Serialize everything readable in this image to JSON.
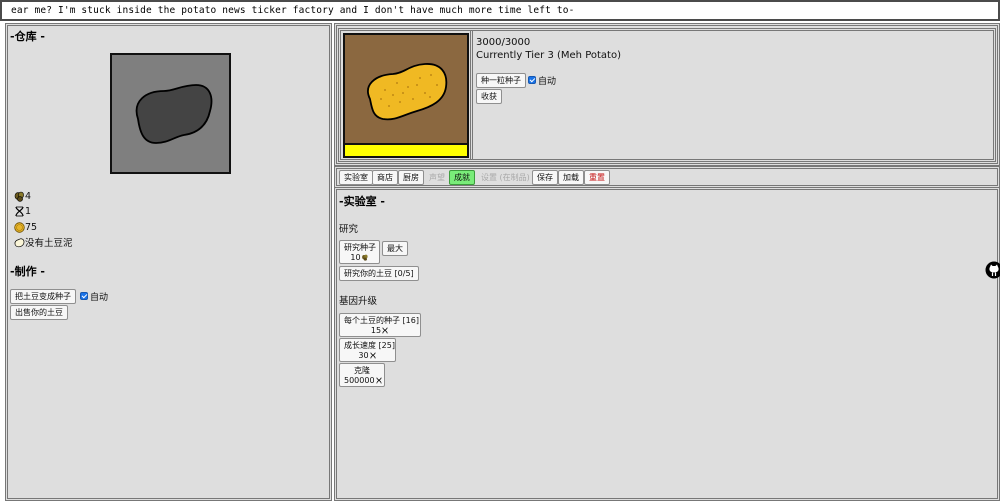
{
  "ticker": {
    "text": "ear me? I'm stuck inside the potato news ticker factory and I don't have much more time left to-"
  },
  "storage": {
    "title": "-仓库 -",
    "stats": [
      {
        "icon": "seed-icon",
        "value": "4"
      },
      {
        "icon": "dna-icon",
        "value": "1"
      },
      {
        "icon": "coin-icon",
        "value": "75"
      },
      {
        "icon": "potato-outline-icon",
        "value": "没有土豆泥"
      }
    ]
  },
  "crafting": {
    "title": "-制作 -",
    "convert_label": "把土豆变成种子",
    "auto_label": "自动",
    "auto_checked": true,
    "sell_label": "出售你的土豆"
  },
  "farm": {
    "progress_text": "3000/3000",
    "progress_fraction": 1.0,
    "tier_text": "Currently Tier 3 (Meh Potato)",
    "plant_label": "种一粒种子",
    "auto_label": "自动",
    "auto_checked": true,
    "harvest_label": "收获"
  },
  "tabs": [
    {
      "label": "实验室",
      "state": "normal"
    },
    {
      "label": "商店",
      "state": "normal"
    },
    {
      "label": "厨房",
      "state": "normal"
    },
    {
      "label": "声望",
      "state": "disabled"
    },
    {
      "label": "成就",
      "state": "active"
    },
    {
      "label": "设置 (在制品)",
      "state": "disabled"
    },
    {
      "label": "保存",
      "state": "normal"
    },
    {
      "label": "加载",
      "state": "normal"
    },
    {
      "label": "重置",
      "state": "danger"
    }
  ],
  "lab": {
    "title": "-实验室 -",
    "research_heading": "研究",
    "research_seeds_label": "研究种子",
    "research_seeds_cost": "10",
    "max_label": "最大",
    "research_potato_label": "研究你的土豆 [0/5]",
    "gene_heading": "基因升级",
    "upgrades": [
      {
        "label": "每个土豆的种子 [16]",
        "cost": "15"
      },
      {
        "label": "成长速度 [25]",
        "cost": "30"
      },
      {
        "label": "克隆",
        "cost": "500000"
      }
    ]
  },
  "colors": {
    "panel_bg": "#dedede",
    "soil": "#8b6840",
    "potato": "#f0b923",
    "progress_bar": "#ffff00",
    "active_tab": "#79ec79",
    "danger_text": "#c41010",
    "storage_frame": "#7f7f7f"
  }
}
